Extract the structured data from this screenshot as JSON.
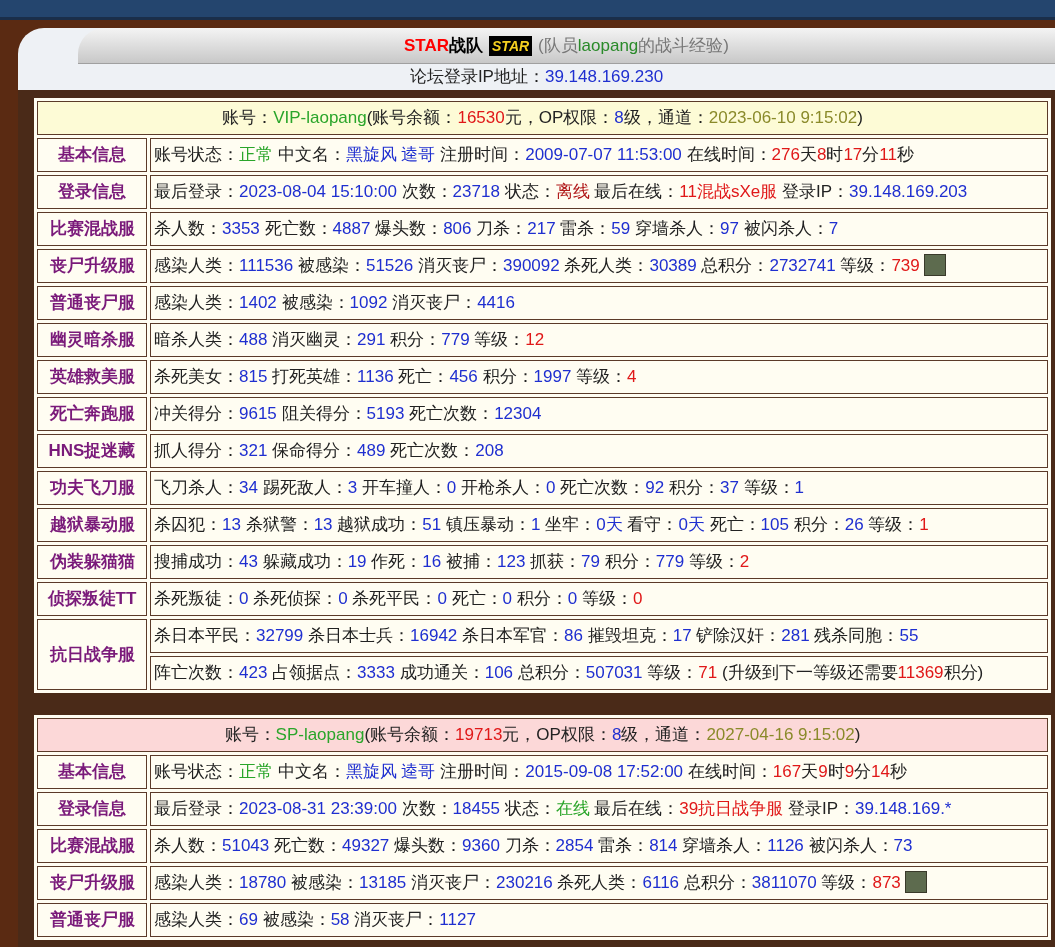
{
  "header": {
    "team": "STAR",
    "team_suffix": "战队",
    "logo": "STAR",
    "subtitle_open": "(队员",
    "member": "laopang",
    "subtitle_close": "的战斗经验)"
  },
  "forum_ip": {
    "label": "论坛登录IP地址：",
    "value": "39.148.169.230"
  },
  "accounts": [
    {
      "color": "#fdfbd6",
      "summary": [
        {
          "kind": "label",
          "text": "账号："
        },
        {
          "kind": "ok",
          "text": "VIP-laopang"
        },
        {
          "kind": "label",
          "text": "(账号余额："
        },
        {
          "kind": "alert",
          "text": "16530"
        },
        {
          "kind": "label",
          "text": "元，OP权限："
        },
        {
          "kind": "value",
          "text": "8"
        },
        {
          "kind": "label",
          "text": "级，通道："
        },
        {
          "kind": "date",
          "text": "2023-06-10 9:15:02"
        },
        {
          "kind": "label",
          "text": ")"
        }
      ],
      "rows": [
        {
          "label": "基本信息",
          "lines": [
            [
              {
                "kind": "label",
                "text": "账号状态："
              },
              {
                "kind": "ok",
                "text": "正常"
              },
              {
                "kind": "label",
                "text": " 中文名："
              },
              {
                "kind": "value",
                "text": "黑旋风 逵哥"
              },
              {
                "kind": "label",
                "text": " 注册时间："
              },
              {
                "kind": "value",
                "text": "2009-07-07 11:53:00"
              },
              {
                "kind": "label",
                "text": " 在线时间："
              },
              {
                "kind": "alert",
                "text": "276"
              },
              {
                "kind": "label",
                "text": "天"
              },
              {
                "kind": "alert",
                "text": "8"
              },
              {
                "kind": "label",
                "text": "时"
              },
              {
                "kind": "alert",
                "text": "17"
              },
              {
                "kind": "label",
                "text": "分"
              },
              {
                "kind": "alert",
                "text": "11"
              },
              {
                "kind": "label",
                "text": "秒"
              }
            ]
          ]
        },
        {
          "label": "登录信息",
          "lines": [
            [
              {
                "kind": "label",
                "text": "最后登录："
              },
              {
                "kind": "value",
                "text": "2023-08-04 15:10:00"
              },
              {
                "kind": "label",
                "text": " 次数："
              },
              {
                "kind": "value",
                "text": "23718"
              },
              {
                "kind": "label",
                "text": " 状态："
              },
              {
                "kind": "offline",
                "text": "离线"
              },
              {
                "kind": "label",
                "text": " 最后在线："
              },
              {
                "kind": "alert",
                "text": "11混战sXe服"
              },
              {
                "kind": "label",
                "text": " 登录IP："
              },
              {
                "kind": "value",
                "text": "39.148.169.203"
              }
            ]
          ]
        },
        {
          "label": "比赛混战服",
          "lines": [
            [
              {
                "kind": "label",
                "text": "杀人数："
              },
              {
                "kind": "value",
                "text": "3353"
              },
              {
                "kind": "label",
                "text": " 死亡数："
              },
              {
                "kind": "value",
                "text": "4887"
              },
              {
                "kind": "label",
                "text": " 爆头数："
              },
              {
                "kind": "value",
                "text": "806"
              },
              {
                "kind": "label",
                "text": " 刀杀："
              },
              {
                "kind": "value",
                "text": "217"
              },
              {
                "kind": "label",
                "text": " 雷杀："
              },
              {
                "kind": "value",
                "text": "59"
              },
              {
                "kind": "label",
                "text": " 穿墙杀人："
              },
              {
                "kind": "value",
                "text": "97"
              },
              {
                "kind": "label",
                "text": " 被闪杀人："
              },
              {
                "kind": "value",
                "text": "7"
              }
            ]
          ]
        },
        {
          "label": "丧尸升级服",
          "lines": [
            [
              {
                "kind": "label",
                "text": "感染人类："
              },
              {
                "kind": "value",
                "text": "111536"
              },
              {
                "kind": "label",
                "text": " 被感染："
              },
              {
                "kind": "value",
                "text": "51526"
              },
              {
                "kind": "label",
                "text": " 消灭丧尸："
              },
              {
                "kind": "value",
                "text": "390092"
              },
              {
                "kind": "label",
                "text": " 杀死人类："
              },
              {
                "kind": "value",
                "text": "30389"
              },
              {
                "kind": "label",
                "text": " 总积分："
              },
              {
                "kind": "value",
                "text": "2732741"
              },
              {
                "kind": "label",
                "text": " 等级："
              },
              {
                "kind": "alert",
                "text": "739"
              },
              {
                "kind": "avatar"
              }
            ]
          ]
        },
        {
          "label": "普通丧尸服",
          "lines": [
            [
              {
                "kind": "label",
                "text": "感染人类："
              },
              {
                "kind": "value",
                "text": "1402"
              },
              {
                "kind": "label",
                "text": " 被感染："
              },
              {
                "kind": "value",
                "text": "1092"
              },
              {
                "kind": "label",
                "text": " 消灭丧尸："
              },
              {
                "kind": "value",
                "text": "4416"
              }
            ]
          ]
        },
        {
          "label": "幽灵暗杀服",
          "lines": [
            [
              {
                "kind": "label",
                "text": "暗杀人类："
              },
              {
                "kind": "value",
                "text": "488"
              },
              {
                "kind": "label",
                "text": " 消灭幽灵："
              },
              {
                "kind": "value",
                "text": "291"
              },
              {
                "kind": "label",
                "text": " 积分："
              },
              {
                "kind": "value",
                "text": "779"
              },
              {
                "kind": "label",
                "text": " 等级："
              },
              {
                "kind": "alert",
                "text": "12"
              }
            ]
          ]
        },
        {
          "label": "英雄救美服",
          "lines": [
            [
              {
                "kind": "label",
                "text": "杀死美女："
              },
              {
                "kind": "value",
                "text": "815"
              },
              {
                "kind": "label",
                "text": " 打死英雄："
              },
              {
                "kind": "value",
                "text": "1136"
              },
              {
                "kind": "label",
                "text": " 死亡："
              },
              {
                "kind": "value",
                "text": "456"
              },
              {
                "kind": "label",
                "text": " 积分："
              },
              {
                "kind": "value",
                "text": "1997"
              },
              {
                "kind": "label",
                "text": " 等级："
              },
              {
                "kind": "alert",
                "text": "4"
              }
            ]
          ]
        },
        {
          "label": "死亡奔跑服",
          "lines": [
            [
              {
                "kind": "label",
                "text": "冲关得分："
              },
              {
                "kind": "value",
                "text": "9615"
              },
              {
                "kind": "label",
                "text": " 阻关得分："
              },
              {
                "kind": "value",
                "text": "5193"
              },
              {
                "kind": "label",
                "text": " 死亡次数："
              },
              {
                "kind": "value",
                "text": "12304"
              }
            ]
          ]
        },
        {
          "label": "HNS捉迷藏",
          "lines": [
            [
              {
                "kind": "label",
                "text": "抓人得分："
              },
              {
                "kind": "value",
                "text": "321"
              },
              {
                "kind": "label",
                "text": " 保命得分："
              },
              {
                "kind": "value",
                "text": "489"
              },
              {
                "kind": "label",
                "text": " 死亡次数："
              },
              {
                "kind": "value",
                "text": "208"
              }
            ]
          ]
        },
        {
          "label": "功夫飞刀服",
          "lines": [
            [
              {
                "kind": "label",
                "text": "飞刀杀人："
              },
              {
                "kind": "value",
                "text": "34"
              },
              {
                "kind": "label",
                "text": " 踢死敌人："
              },
              {
                "kind": "value",
                "text": "3"
              },
              {
                "kind": "label",
                "text": " 开车撞人："
              },
              {
                "kind": "value",
                "text": "0"
              },
              {
                "kind": "label",
                "text": " 开枪杀人："
              },
              {
                "kind": "value",
                "text": "0"
              },
              {
                "kind": "label",
                "text": " 死亡次数："
              },
              {
                "kind": "value",
                "text": "92"
              },
              {
                "kind": "label",
                "text": " 积分："
              },
              {
                "kind": "value",
                "text": "37"
              },
              {
                "kind": "label",
                "text": " 等级："
              },
              {
                "kind": "value",
                "text": "1"
              }
            ]
          ]
        },
        {
          "label": "越狱暴动服",
          "lines": [
            [
              {
                "kind": "label",
                "text": "杀囚犯："
              },
              {
                "kind": "value",
                "text": "13"
              },
              {
                "kind": "label",
                "text": " 杀狱警："
              },
              {
                "kind": "value",
                "text": "13"
              },
              {
                "kind": "label",
                "text": " 越狱成功："
              },
              {
                "kind": "value",
                "text": "51"
              },
              {
                "kind": "label",
                "text": " 镇压暴动："
              },
              {
                "kind": "value",
                "text": "1"
              },
              {
                "kind": "label",
                "text": " 坐牢："
              },
              {
                "kind": "value",
                "text": "0天"
              },
              {
                "kind": "label",
                "text": " 看守："
              },
              {
                "kind": "value",
                "text": "0天"
              },
              {
                "kind": "label",
                "text": " 死亡："
              },
              {
                "kind": "value",
                "text": "105"
              },
              {
                "kind": "label",
                "text": " 积分："
              },
              {
                "kind": "value",
                "text": "26"
              },
              {
                "kind": "label",
                "text": " 等级："
              },
              {
                "kind": "alert",
                "text": "1"
              }
            ]
          ]
        },
        {
          "label": "伪装躲猫猫",
          "lines": [
            [
              {
                "kind": "label",
                "text": "搜捕成功："
              },
              {
                "kind": "value",
                "text": "43"
              },
              {
                "kind": "label",
                "text": " 躲藏成功："
              },
              {
                "kind": "value",
                "text": "19"
              },
              {
                "kind": "label",
                "text": " 作死："
              },
              {
                "kind": "value",
                "text": "16"
              },
              {
                "kind": "label",
                "text": " 被捕："
              },
              {
                "kind": "value",
                "text": "123"
              },
              {
                "kind": "label",
                "text": " 抓获："
              },
              {
                "kind": "value",
                "text": "79"
              },
              {
                "kind": "label",
                "text": " 积分："
              },
              {
                "kind": "value",
                "text": "779"
              },
              {
                "kind": "label",
                "text": " 等级："
              },
              {
                "kind": "alert",
                "text": "2"
              }
            ]
          ]
        },
        {
          "label": "侦探叛徒TT",
          "lines": [
            [
              {
                "kind": "label",
                "text": "杀死叛徒："
              },
              {
                "kind": "value",
                "text": "0"
              },
              {
                "kind": "label",
                "text": " 杀死侦探："
              },
              {
                "kind": "value",
                "text": "0"
              },
              {
                "kind": "label",
                "text": " 杀死平民："
              },
              {
                "kind": "value",
                "text": "0"
              },
              {
                "kind": "label",
                "text": " 死亡："
              },
              {
                "kind": "value",
                "text": "0"
              },
              {
                "kind": "label",
                "text": " 积分："
              },
              {
                "kind": "value",
                "text": "0"
              },
              {
                "kind": "label",
                "text": " 等级："
              },
              {
                "kind": "alert",
                "text": "0"
              }
            ]
          ]
        },
        {
          "label": "抗日战争服",
          "lines": [
            [
              {
                "kind": "label",
                "text": "杀日本平民："
              },
              {
                "kind": "value",
                "text": "32799"
              },
              {
                "kind": "label",
                "text": " 杀日本士兵："
              },
              {
                "kind": "value",
                "text": "16942"
              },
              {
                "kind": "label",
                "text": " 杀日本军官："
              },
              {
                "kind": "value",
                "text": "86"
              },
              {
                "kind": "label",
                "text": " 摧毁坦克："
              },
              {
                "kind": "value",
                "text": "17"
              },
              {
                "kind": "label",
                "text": " 铲除汉奸："
              },
              {
                "kind": "value",
                "text": "281"
              },
              {
                "kind": "label",
                "text": " 残杀同胞："
              },
              {
                "kind": "value",
                "text": "55"
              }
            ],
            [
              {
                "kind": "label",
                "text": "阵亡次数："
              },
              {
                "kind": "value",
                "text": "423"
              },
              {
                "kind": "label",
                "text": " 占领据点："
              },
              {
                "kind": "value",
                "text": "3333"
              },
              {
                "kind": "label",
                "text": " 成功通关："
              },
              {
                "kind": "value",
                "text": "106"
              },
              {
                "kind": "label",
                "text": " 总积分："
              },
              {
                "kind": "value",
                "text": "507031"
              },
              {
                "kind": "label",
                "text": " 等级："
              },
              {
                "kind": "alert",
                "text": "71"
              },
              {
                "kind": "label",
                "text": " (升级到下一等级还需要"
              },
              {
                "kind": "alert",
                "text": "11369"
              },
              {
                "kind": "label",
                "text": "积分)"
              }
            ]
          ]
        }
      ]
    },
    {
      "color": "#fcd8d8",
      "summary": [
        {
          "kind": "label",
          "text": "账号："
        },
        {
          "kind": "ok",
          "text": "SP-laopang"
        },
        {
          "kind": "label",
          "text": "(账号余额："
        },
        {
          "kind": "alert",
          "text": "19713"
        },
        {
          "kind": "label",
          "text": "元，OP权限："
        },
        {
          "kind": "value",
          "text": "8"
        },
        {
          "kind": "label",
          "text": "级，通道："
        },
        {
          "kind": "date",
          "text": "2027-04-16 9:15:02"
        },
        {
          "kind": "label",
          "text": ")"
        }
      ],
      "rows": [
        {
          "label": "基本信息",
          "lines": [
            [
              {
                "kind": "label",
                "text": "账号状态："
              },
              {
                "kind": "ok",
                "text": "正常"
              },
              {
                "kind": "label",
                "text": " 中文名："
              },
              {
                "kind": "value",
                "text": "黑旋风 逵哥"
              },
              {
                "kind": "label",
                "text": " 注册时间："
              },
              {
                "kind": "value",
                "text": "2015-09-08 17:52:00"
              },
              {
                "kind": "label",
                "text": " 在线时间："
              },
              {
                "kind": "alert",
                "text": "167"
              },
              {
                "kind": "label",
                "text": "天"
              },
              {
                "kind": "alert",
                "text": "9"
              },
              {
                "kind": "label",
                "text": "时"
              },
              {
                "kind": "alert",
                "text": "9"
              },
              {
                "kind": "label",
                "text": "分"
              },
              {
                "kind": "alert",
                "text": "14"
              },
              {
                "kind": "label",
                "text": "秒"
              }
            ]
          ]
        },
        {
          "label": "登录信息",
          "lines": [
            [
              {
                "kind": "label",
                "text": "最后登录："
              },
              {
                "kind": "value",
                "text": "2023-08-31 23:39:00"
              },
              {
                "kind": "label",
                "text": " 次数："
              },
              {
                "kind": "value",
                "text": "18455"
              },
              {
                "kind": "label",
                "text": " 状态："
              },
              {
                "kind": "ok",
                "text": "在线"
              },
              {
                "kind": "label",
                "text": " 最后在线："
              },
              {
                "kind": "alert",
                "text": "39抗日战争服"
              },
              {
                "kind": "label",
                "text": " 登录IP："
              },
              {
                "kind": "value",
                "text": "39.148.169.*"
              }
            ]
          ]
        },
        {
          "label": "比赛混战服",
          "lines": [
            [
              {
                "kind": "label",
                "text": "杀人数："
              },
              {
                "kind": "value",
                "text": "51043"
              },
              {
                "kind": "label",
                "text": " 死亡数："
              },
              {
                "kind": "value",
                "text": "49327"
              },
              {
                "kind": "label",
                "text": " 爆头数："
              },
              {
                "kind": "value",
                "text": "9360"
              },
              {
                "kind": "label",
                "text": " 刀杀："
              },
              {
                "kind": "value",
                "text": "2854"
              },
              {
                "kind": "label",
                "text": " 雷杀："
              },
              {
                "kind": "value",
                "text": "814"
              },
              {
                "kind": "label",
                "text": " 穿墙杀人："
              },
              {
                "kind": "value",
                "text": "1126"
              },
              {
                "kind": "label",
                "text": " 被闪杀人："
              },
              {
                "kind": "value",
                "text": "73"
              }
            ]
          ]
        },
        {
          "label": "丧尸升级服",
          "lines": [
            [
              {
                "kind": "label",
                "text": "感染人类："
              },
              {
                "kind": "value",
                "text": "18780"
              },
              {
                "kind": "label",
                "text": " 被感染："
              },
              {
                "kind": "value",
                "text": "13185"
              },
              {
                "kind": "label",
                "text": " 消灭丧尸："
              },
              {
                "kind": "value",
                "text": "230216"
              },
              {
                "kind": "label",
                "text": " 杀死人类："
              },
              {
                "kind": "value",
                "text": "6116"
              },
              {
                "kind": "label",
                "text": " 总积分："
              },
              {
                "kind": "value",
                "text": "3811070"
              },
              {
                "kind": "label",
                "text": " 等级："
              },
              {
                "kind": "alert",
                "text": "873"
              },
              {
                "kind": "avatar"
              }
            ]
          ]
        },
        {
          "label": "普通丧尸服",
          "lines": [
            [
              {
                "kind": "label",
                "text": "感染人类："
              },
              {
                "kind": "value",
                "text": "69"
              },
              {
                "kind": "label",
                "text": " 被感染："
              },
              {
                "kind": "value",
                "text": "58"
              },
              {
                "kind": "label",
                "text": " 消灭丧尸："
              },
              {
                "kind": "value",
                "text": "1127"
              }
            ]
          ]
        }
      ]
    }
  ]
}
